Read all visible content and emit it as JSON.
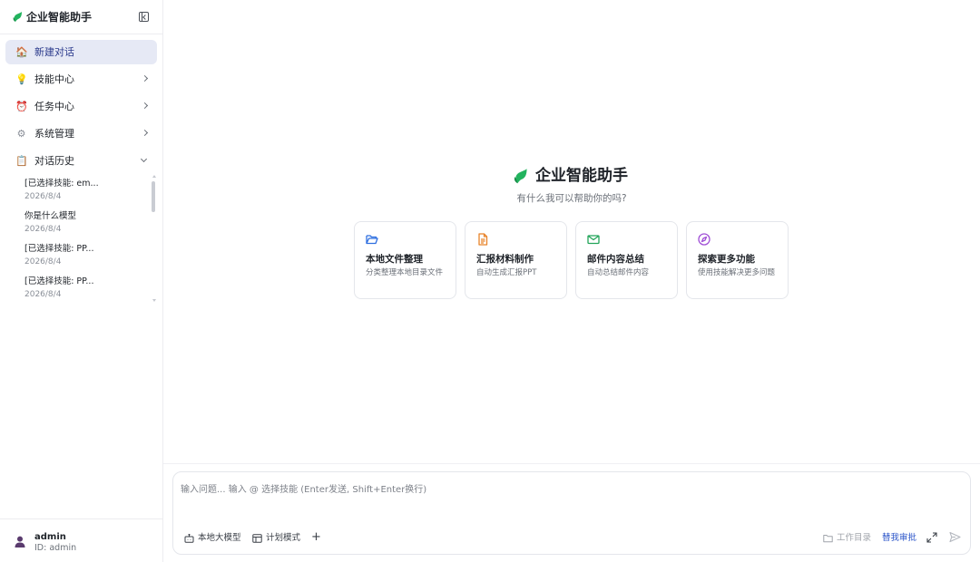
{
  "app": {
    "title": "企业智能助手",
    "brand_color": "#22b35e"
  },
  "sidebar": {
    "items": [
      {
        "label": "新建对话",
        "icon": "house-icon",
        "active": true
      },
      {
        "label": "技能中心",
        "icon": "lightbulb-icon"
      },
      {
        "label": "任务中心",
        "icon": "alarm-clock-icon"
      },
      {
        "label": "系统管理",
        "icon": "gear-icon"
      },
      {
        "label": "对话历史",
        "icon": "clipboard-icon",
        "expanded": true
      }
    ],
    "history": [
      {
        "title": "[已选择技能: em...",
        "date": "2026/8/4"
      },
      {
        "title": "你是什么模型",
        "date": "2026/8/4"
      },
      {
        "title": "[已选择技能: PP...",
        "date": "2026/8/4"
      },
      {
        "title": "[已选择技能: PP...",
        "date": "2026/8/4"
      }
    ],
    "user": {
      "name": "admin",
      "id": "ID: admin"
    }
  },
  "main": {
    "title": "企业智能助手",
    "subtitle": "有什么我可以帮助你的吗?",
    "cards": [
      {
        "title": "本地文件整理",
        "desc": "分类整理本地目录文件",
        "icon": "folder-open-icon",
        "color": "#2f6fe0"
      },
      {
        "title": "汇报材料制作",
        "desc": "自动生成汇报PPT",
        "icon": "document-icon",
        "color": "#e8842a"
      },
      {
        "title": "邮件内容总结",
        "desc": "自动总结邮件内容",
        "icon": "mail-icon",
        "color": "#22a559"
      },
      {
        "title": "探索更多功能",
        "desc": "使用技能解决更多问题",
        "icon": "compass-icon",
        "color": "#a04fd6"
      }
    ]
  },
  "composer": {
    "placeholder": "输入问题... 输入 @ 选择技能 (Enter发送, Shift+Enter换行)",
    "value": "",
    "local_model_label": "本地大模型",
    "plan_mode_label": "计划模式",
    "add_label": "+",
    "workdir_label": "工作目录",
    "approve_label": "替我审批"
  }
}
